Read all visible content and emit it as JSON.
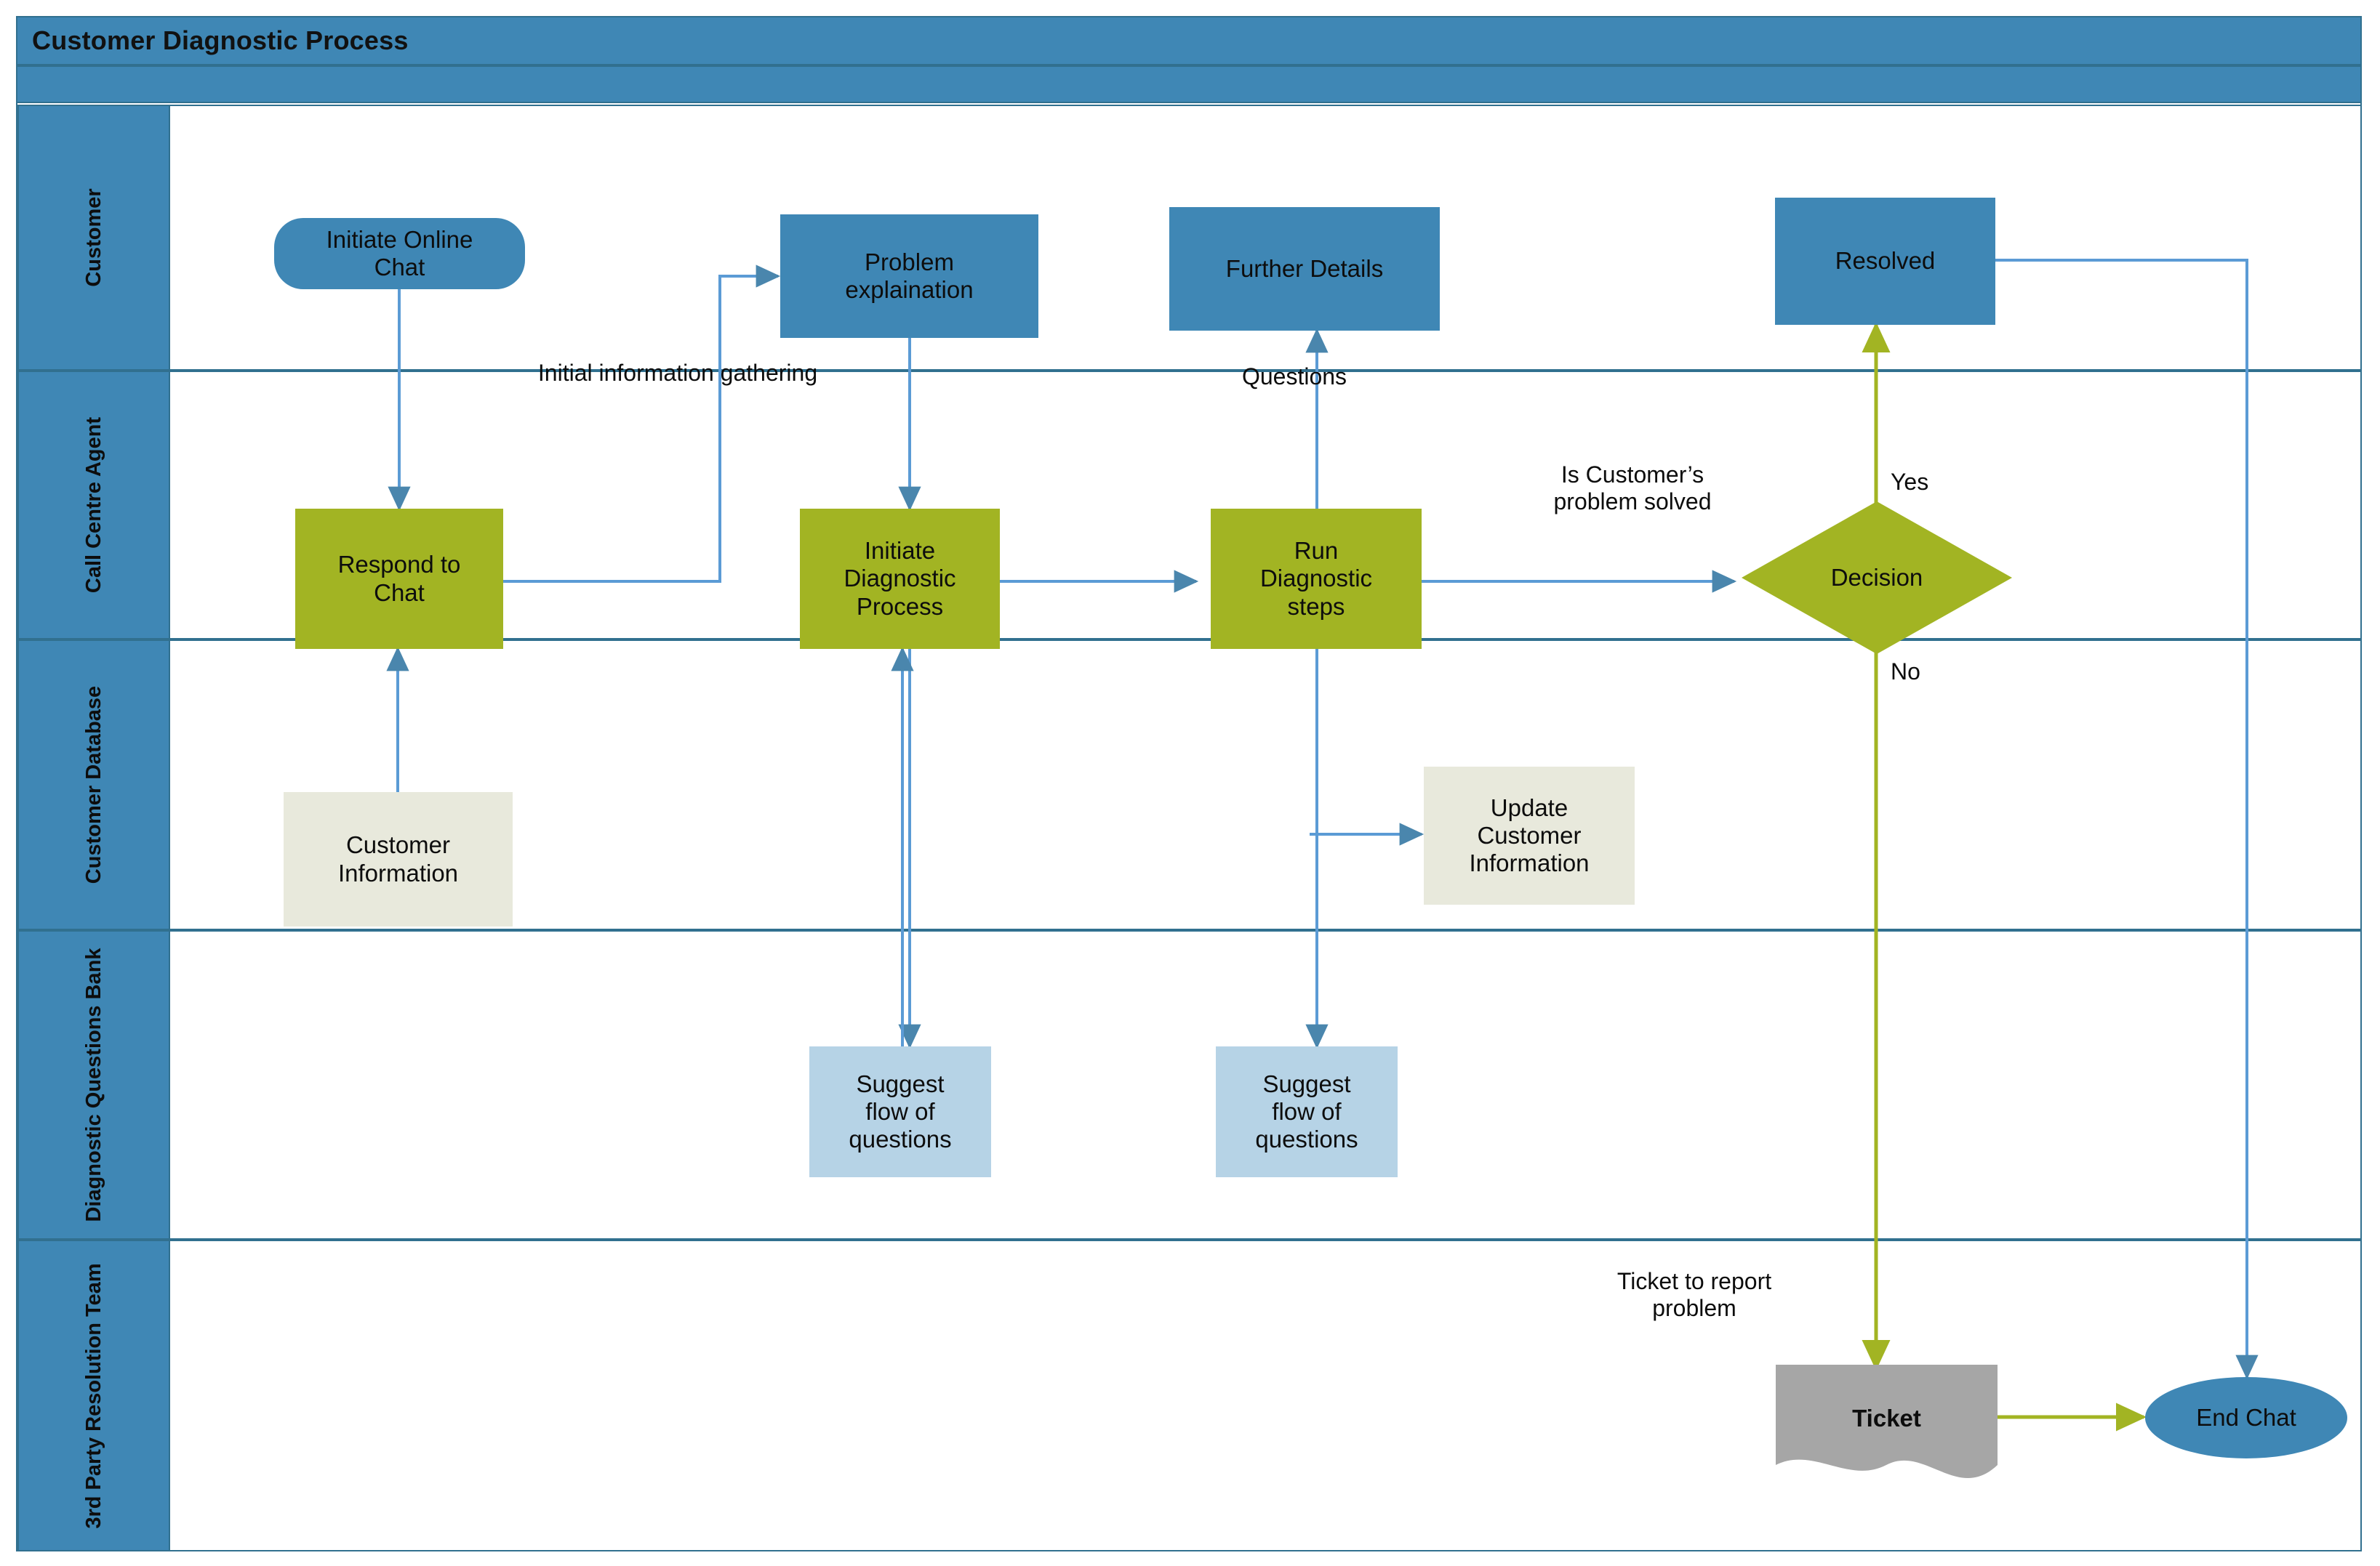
{
  "diagram": {
    "title": "Customer Diagnostic Process",
    "type": "swimlane-flowchart",
    "colors": {
      "lane_header": "#3f87b5",
      "lane_border": "#31708f",
      "blue_shape": "#3f87b5",
      "olive_shape": "#a2b423",
      "cream_shape": "#e8e9dc",
      "light_blue_shape": "#b6d3e6",
      "gray_shape": "#a6a6a6",
      "blue_connector": "#5b9bd5",
      "olive_connector": "#a2b423"
    }
  },
  "lanes": [
    {
      "id": "customer",
      "label": "Customer"
    },
    {
      "id": "agent",
      "label": "Call Centre\nAgent"
    },
    {
      "id": "database",
      "label": "Customer\nDatabase"
    },
    {
      "id": "qbank",
      "label": "Diagnostic\nQuestions\nBank"
    },
    {
      "id": "thirdparty",
      "label": "3rd Party\nResolution Team"
    }
  ],
  "nodes": {
    "initiate_online_chat": {
      "label": "Initiate Online\nChat",
      "lane": "customer",
      "shape": "rounded-rectangle",
      "fill": "blue"
    },
    "problem_explaination": {
      "label": "Problem\nexplaination",
      "lane": "customer",
      "shape": "rectangle",
      "fill": "blue"
    },
    "further_details": {
      "label": "Further Details",
      "lane": "customer",
      "shape": "rectangle",
      "fill": "blue"
    },
    "resolved": {
      "label": "Resolved",
      "lane": "customer",
      "shape": "rectangle",
      "fill": "blue"
    },
    "respond_to_chat": {
      "label": "Respond to\nChat",
      "lane": "agent",
      "shape": "rectangle",
      "fill": "olive"
    },
    "initiate_diagnostic": {
      "label": "Initiate\nDiagnostic\nProcess",
      "lane": "agent",
      "shape": "rectangle",
      "fill": "olive"
    },
    "run_diagnostic_steps": {
      "label": "Run\nDiagnostic\nsteps",
      "lane": "agent",
      "shape": "rectangle",
      "fill": "olive"
    },
    "decision": {
      "label": "Decision",
      "lane": "agent",
      "shape": "diamond",
      "fill": "olive"
    },
    "customer_information": {
      "label": "Customer\nInformation",
      "lane": "database",
      "shape": "rectangle",
      "fill": "cream"
    },
    "update_customer_information": {
      "label": "Update\nCustomer\nInformation",
      "lane": "database",
      "shape": "rectangle",
      "fill": "cream"
    },
    "suggest_flow_1": {
      "label": "Suggest\nflow of\nquestions",
      "lane": "qbank",
      "shape": "rectangle",
      "fill": "light-blue"
    },
    "suggest_flow_2": {
      "label": "Suggest\nflow of\nquestions",
      "lane": "qbank",
      "shape": "rectangle",
      "fill": "light-blue"
    },
    "ticket": {
      "label": "Ticket",
      "lane": "thirdparty",
      "shape": "document",
      "fill": "gray"
    },
    "end_chat": {
      "label": "End Chat",
      "lane": "thirdparty",
      "shape": "rounded-rectangle",
      "fill": "blue"
    }
  },
  "edge_labels": {
    "initial_information_gathering": "Initial information gathering",
    "questions": "Questions",
    "is_customer_problem_solved": "Is Customer’s\nproblem solved",
    "yes": "Yes",
    "no": "No",
    "ticket_to_report_problem": "Ticket to report\nproblem"
  },
  "edges": [
    {
      "from": "initiate_online_chat",
      "to": "respond_to_chat",
      "color": "blue"
    },
    {
      "from": "respond_to_chat",
      "to": "problem_explaination",
      "label": "initial_information_gathering",
      "color": "blue"
    },
    {
      "from": "problem_explaination",
      "to": "initiate_diagnostic",
      "color": "blue"
    },
    {
      "from": "customer_information",
      "to": "respond_to_chat",
      "color": "blue"
    },
    {
      "from": "initiate_diagnostic",
      "to": "suggest_flow_1",
      "color": "blue"
    },
    {
      "from": "suggest_flow_1",
      "to": "initiate_diagnostic",
      "color": "blue"
    },
    {
      "from": "initiate_diagnostic",
      "to": "run_diagnostic_steps",
      "color": "blue"
    },
    {
      "from": "run_diagnostic_steps",
      "to": "further_details",
      "label": "questions",
      "color": "blue"
    },
    {
      "from": "run_diagnostic_steps",
      "to": "update_customer_information",
      "color": "blue"
    },
    {
      "from": "run_diagnostic_steps",
      "to": "suggest_flow_2",
      "color": "blue"
    },
    {
      "from": "run_diagnostic_steps",
      "to": "decision",
      "label": "is_customer_problem_solved",
      "color": "blue"
    },
    {
      "from": "decision",
      "to": "resolved",
      "label": "yes",
      "color": "olive"
    },
    {
      "from": "decision",
      "to": "ticket",
      "label": "no",
      "color": "olive"
    },
    {
      "from": "ticket",
      "to": "end_chat",
      "color": "olive"
    },
    {
      "from": "resolved",
      "to": "end_chat",
      "color": "blue"
    }
  ]
}
